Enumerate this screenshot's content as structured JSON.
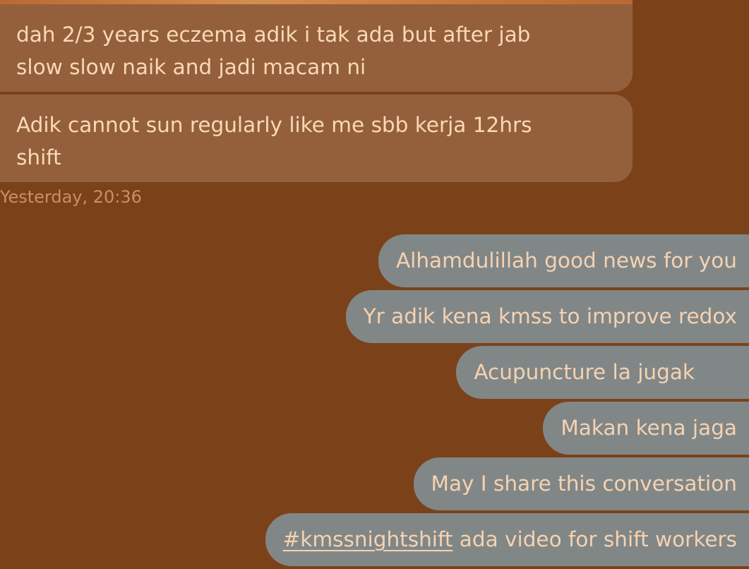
{
  "colors": {
    "background": "#7b4219",
    "incoming_bubble": "#94603c",
    "incoming_text": "#fbd8b6",
    "outgoing_bubble": "#818787",
    "outgoing_text": "#f6d2b1",
    "timestamp_text": "#c99067"
  },
  "chat": {
    "incoming": [
      {
        "line1": "dah 2/3 years eczema adik i tak ada but after jab",
        "line2": "slow slow naik and jadi macam ni"
      },
      {
        "line1": "Adik cannot sun regularly like me sbb kerja 12hrs",
        "line2": "shift"
      }
    ],
    "timestamp": "Yesterday, 20:36",
    "outgoing": [
      {
        "text": "Alhamdulillah good news for you"
      },
      {
        "text": "Yr adik kena kmss to improve redox"
      },
      {
        "text": "Acupuncture la jugak"
      },
      {
        "text": "Makan kena jaga"
      },
      {
        "text": "May I share this conversation"
      },
      {
        "hashtag": "#kmssnightshift",
        "text": " ada video for shift workers"
      }
    ]
  }
}
